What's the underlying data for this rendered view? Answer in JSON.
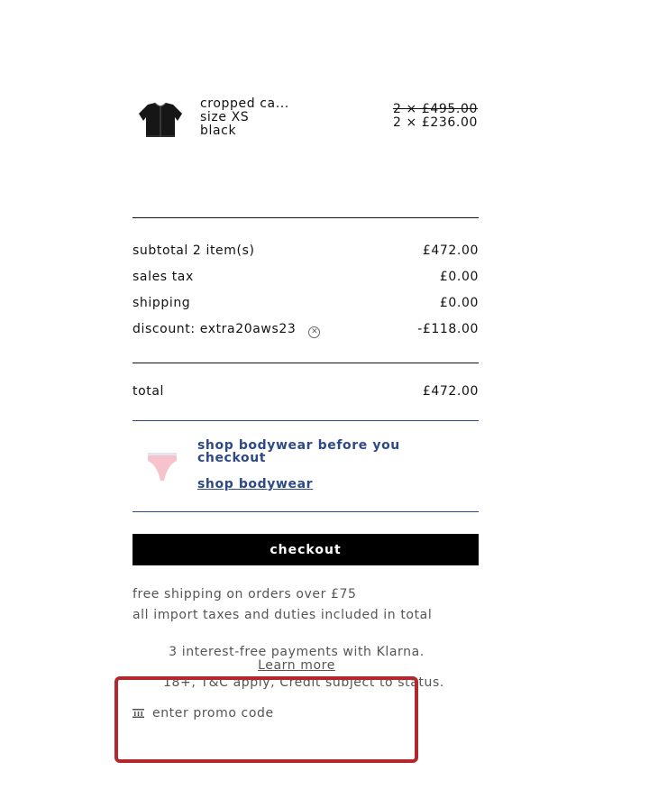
{
  "cart_item": {
    "name": "cropped ca...",
    "size": "size XS",
    "color": "black",
    "price_original": "2 × £495.00",
    "price_current": "2 × £236.00"
  },
  "summary": {
    "subtotal_label": "subtotal   2 item(s)",
    "subtotal_value": "£472.00",
    "tax_label": "sales tax",
    "tax_value": "£0.00",
    "shipping_label": "shipping",
    "shipping_value": "£0.00",
    "discount_label": "discount: extra20aws23",
    "discount_value": "-£118.00",
    "total_label": "total",
    "total_value": "£472.00"
  },
  "upsell": {
    "title": "shop bodywear before you checkout",
    "link": "shop bodywear"
  },
  "checkout_label": "checkout",
  "notes": {
    "free_shipping": "free shipping on orders over £75",
    "import_taxes": "all import taxes and duties included in total"
  },
  "klarna": {
    "line1": "3 interest-free payments with Klarna.",
    "link": "Learn more",
    "line3": "18+, T&C apply, Credit subject to status."
  },
  "promo": {
    "label": "enter promo code"
  },
  "colors": {
    "accent_blue": "#2d4a86",
    "highlight_red": "#b3282d",
    "button_bg": "#000000"
  }
}
